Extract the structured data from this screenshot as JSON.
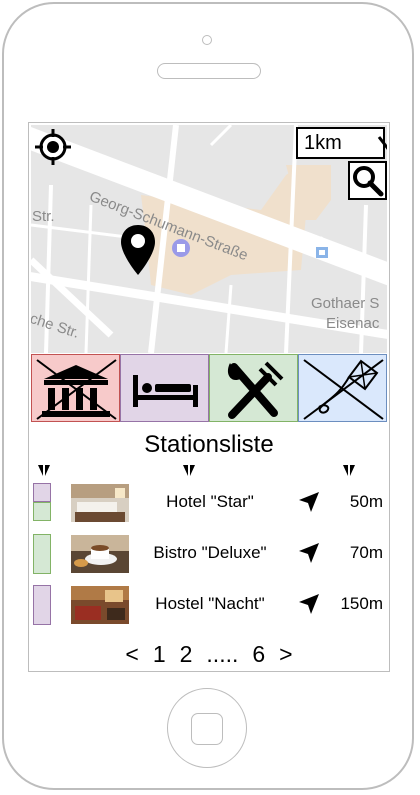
{
  "map": {
    "street_labels": [
      "Georg-Schumann-Straße",
      "Str.",
      "Gothaer S",
      "Eisenac",
      "che Str."
    ]
  },
  "distance_select": {
    "value": "1km"
  },
  "category_buttons": [
    {
      "name": "sights",
      "icon": "museum-icon",
      "state": "crossed-out",
      "color": "#f7caca"
    },
    {
      "name": "lodging",
      "icon": "bed-icon",
      "state": "active",
      "color": "#e1d5e7"
    },
    {
      "name": "food",
      "icon": "cutlery-icon",
      "state": "crossed-out",
      "color": "#d5e8d4"
    },
    {
      "name": "leisure",
      "icon": "kite-icon",
      "state": "crossed-out",
      "color": "#dae8fc"
    }
  ],
  "station_list": {
    "title": "Stationsliste",
    "rows": [
      {
        "name": "Hotel \"Star\"",
        "distance": "50m",
        "colors": [
          "#e1d5e7",
          "#d5e8d4"
        ]
      },
      {
        "name": "Bistro \"Deluxe\"",
        "distance": "70m",
        "colors": [
          "#d5e8d4"
        ]
      },
      {
        "name": "Hostel \"Nacht\"",
        "distance": "150m",
        "colors": [
          "#e1d5e7"
        ]
      }
    ]
  },
  "pagination": {
    "prev": "<",
    "pages": [
      "1",
      "2"
    ],
    "ellipsis": ".....",
    "last": "6",
    "next": ">"
  }
}
